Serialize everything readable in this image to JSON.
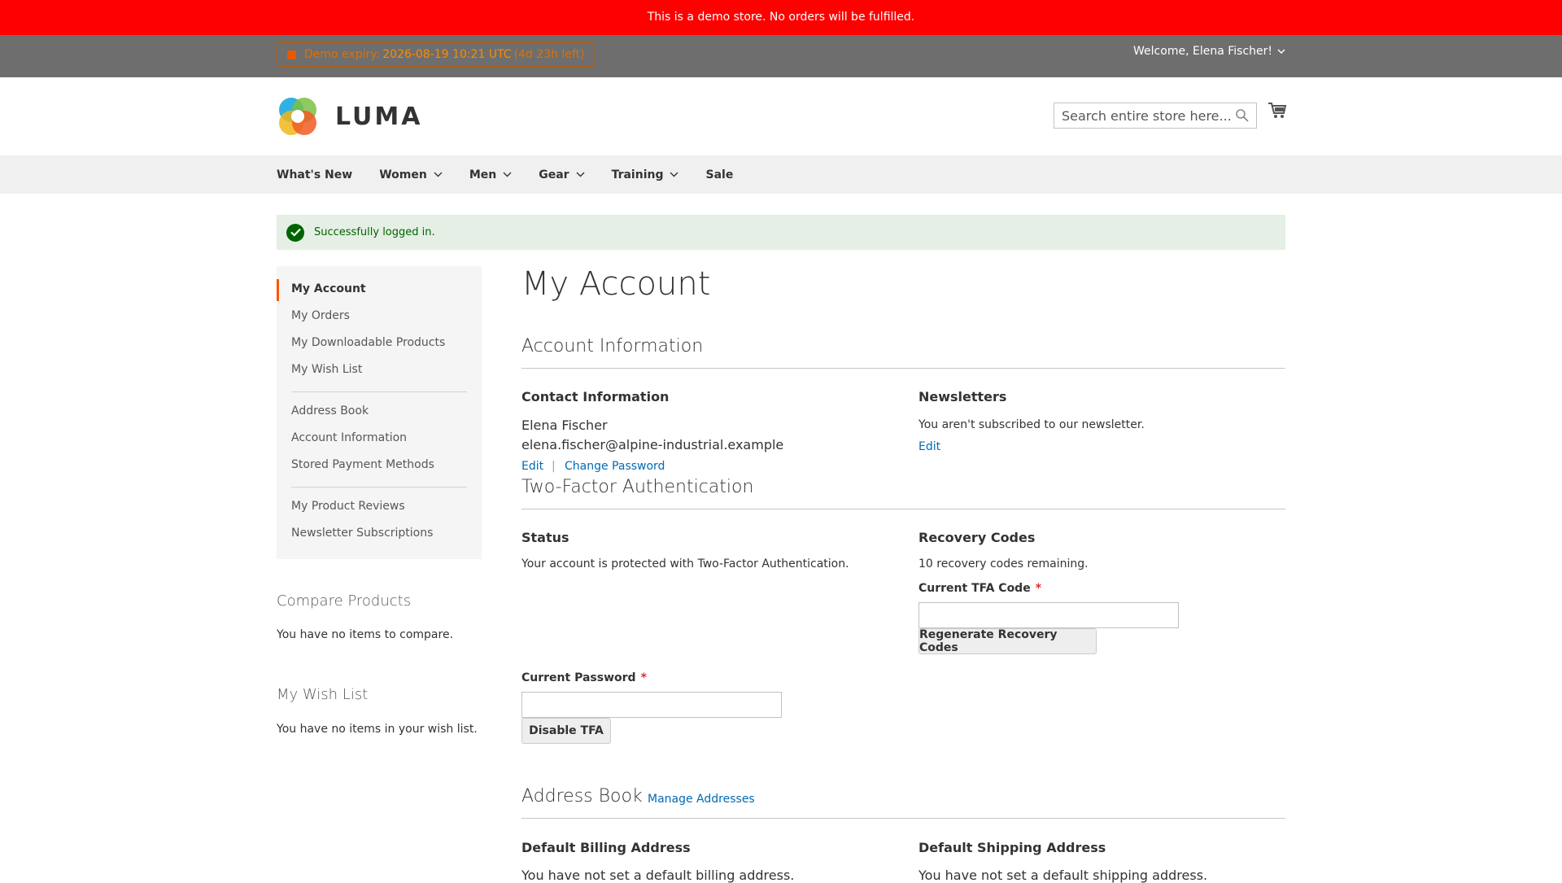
{
  "demo_notice": "This is a demo store. No orders will be fulfilled.",
  "panel": {
    "expiry_label": "Demo expiry:",
    "expiry_date": "2026-08-19 10:21 UTC",
    "expiry_left": "(4d 23h left)",
    "welcome": "Welcome, Elena Fischer!"
  },
  "header": {
    "logo_text": "LUMA",
    "search_placeholder": "Search entire store here..."
  },
  "nav": [
    {
      "label": "What's New"
    },
    {
      "label": "Women"
    },
    {
      "label": "Men"
    },
    {
      "label": "Gear"
    },
    {
      "label": "Training"
    },
    {
      "label": "Sale"
    }
  ],
  "message": "Successfully logged in.",
  "sidebar": {
    "group1": [
      "My Account",
      "My Orders",
      "My Downloadable Products",
      "My Wish List"
    ],
    "group2": [
      "Address Book",
      "Account Information",
      "Stored Payment Methods"
    ],
    "group3": [
      "My Product Reviews",
      "Newsletter Subscriptions"
    ]
  },
  "compare": {
    "title": "Compare Products",
    "text": "You have no items to compare."
  },
  "wishlist": {
    "title": "My Wish List",
    "text": "You have no items in your wish list."
  },
  "main": {
    "title": "My Account",
    "account_info": {
      "title": "Account Information",
      "contact_title": "Contact Information",
      "name": "Elena Fischer",
      "email": "elena.fischer@alpine-industrial.example",
      "edit": "Edit",
      "separator": "|",
      "change_password": "Change Password",
      "newsletters_title": "Newsletters",
      "newsletters_text": "You aren't subscribed to our newsletter.",
      "newsletters_edit": "Edit"
    },
    "tfa": {
      "title": "Two-Factor Authentication",
      "status_title": "Status",
      "status_text": "Your account is protected with Two-Factor Authentication.",
      "recovery_title": "Recovery Codes",
      "recovery_text": "10 recovery codes remaining.",
      "tfa_code_label": "Current TFA Code",
      "required_mark": "*",
      "regenerate_button": "Regenerate Recovery Codes",
      "password_label": "Current Password",
      "disable_button": "Disable TFA"
    },
    "address_book": {
      "title": "Address Book",
      "manage": "Manage Addresses",
      "billing_title": "Default Billing Address",
      "billing_text": "You have not set a default billing address.",
      "shipping_title": "Default Shipping Address",
      "shipping_text": "You have not set a default shipping address."
    }
  }
}
